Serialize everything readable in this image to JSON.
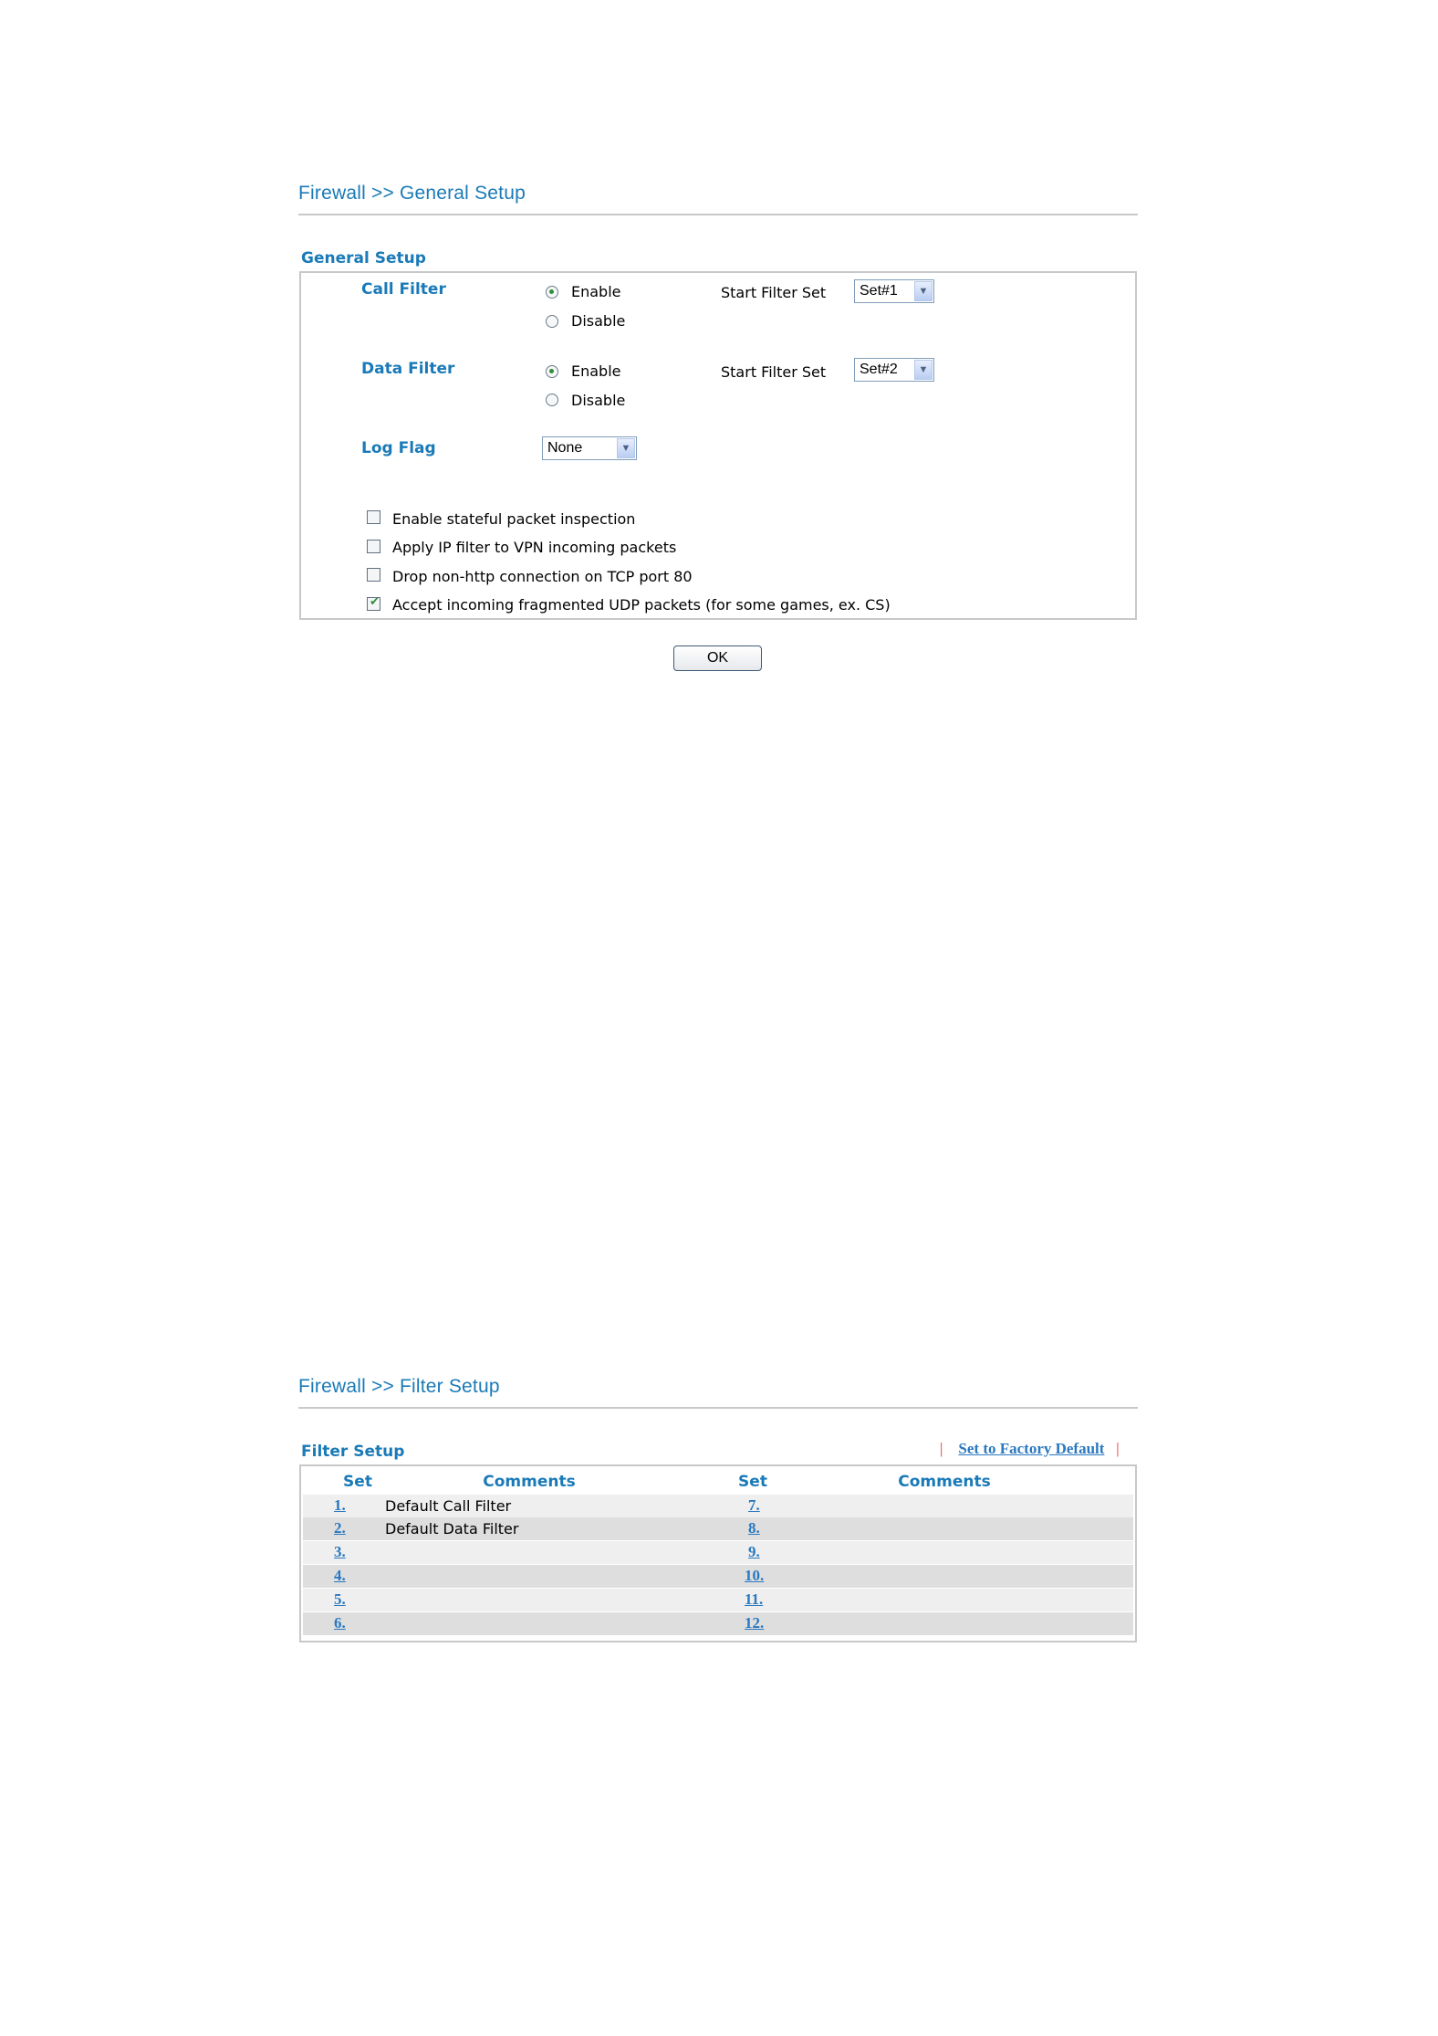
{
  "general": {
    "title": "Firewall >> General Setup",
    "section": "General Setup",
    "call_filter": {
      "label": "Call Filter",
      "enable": "Enable",
      "disable": "Disable",
      "selected": "Enable",
      "start_label": "Start Filter Set",
      "start_value": "Set#1"
    },
    "data_filter": {
      "label": "Data Filter",
      "enable": "Enable",
      "disable": "Disable",
      "selected": "Enable",
      "start_label": "Start Filter Set",
      "start_value": "Set#2"
    },
    "log_flag": {
      "label": "Log Flag",
      "value": "None"
    },
    "options": [
      {
        "label": "Enable stateful packet inspection",
        "checked": false
      },
      {
        "label": "Apply IP filter to VPN incoming packets",
        "checked": false
      },
      {
        "label": "Drop non-http connection on TCP port 80",
        "checked": false
      },
      {
        "label": "Accept incoming fragmented UDP packets (for some games, ex. CS)",
        "checked": true
      }
    ],
    "ok_label": "OK"
  },
  "filter": {
    "title": "Firewall >> Filter Setup",
    "section": "Filter Setup",
    "factory_link": "Set to Factory Default",
    "separator": "|",
    "headers": {
      "set": "Set",
      "comments": "Comments"
    },
    "rows": [
      {
        "left_set": "1.",
        "left_comment": "Default Call Filter",
        "right_set": "7.",
        "right_comment": ""
      },
      {
        "left_set": "2.",
        "left_comment": "Default Data Filter",
        "right_set": "8.",
        "right_comment": ""
      },
      {
        "left_set": "3.",
        "left_comment": "",
        "right_set": "9.",
        "right_comment": ""
      },
      {
        "left_set": "4.",
        "left_comment": "",
        "right_set": "10.",
        "right_comment": ""
      },
      {
        "left_set": "5.",
        "left_comment": "",
        "right_set": "11.",
        "right_comment": ""
      },
      {
        "left_set": "6.",
        "left_comment": "",
        "right_set": "12.",
        "right_comment": ""
      }
    ]
  }
}
